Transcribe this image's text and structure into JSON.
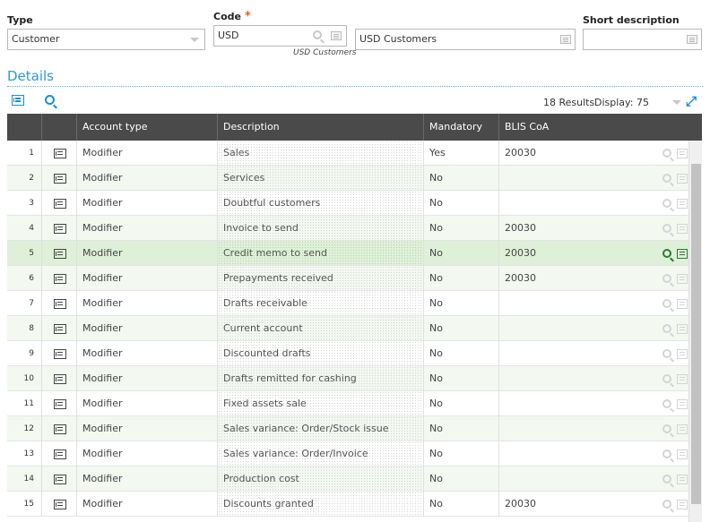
{
  "form": {
    "type": {
      "label": "Type",
      "value": "Customer"
    },
    "code": {
      "label": "Code",
      "required_marker": "*",
      "value": "USD",
      "caption": "USD Customers"
    },
    "description": {
      "value": "USD Customers"
    },
    "short_description": {
      "label": "Short description",
      "value": ""
    }
  },
  "details": {
    "title": "Details",
    "results": "18 Results",
    "display_label": "Display:",
    "display_value": "75"
  },
  "table": {
    "columns": [
      "Account type",
      "Description",
      "Mandatory",
      "BLIS CoA"
    ],
    "rows": [
      {
        "num": "1",
        "account_type": "Modifier",
        "description": "Sales",
        "mandatory": "Yes",
        "blis": "20030"
      },
      {
        "num": "2",
        "account_type": "Modifier",
        "description": "Services",
        "mandatory": "No",
        "blis": ""
      },
      {
        "num": "3",
        "account_type": "Modifier",
        "description": "Doubtful customers",
        "mandatory": "No",
        "blis": ""
      },
      {
        "num": "4",
        "account_type": "Modifier",
        "description": "Invoice to send",
        "mandatory": "No",
        "blis": "20030"
      },
      {
        "num": "5",
        "account_type": "Modifier",
        "description": "Credit memo to send",
        "mandatory": "No",
        "blis": "20030"
      },
      {
        "num": "6",
        "account_type": "Modifier",
        "description": "Prepayments received",
        "mandatory": "No",
        "blis": "20030"
      },
      {
        "num": "7",
        "account_type": "Modifier",
        "description": "Drafts receivable",
        "mandatory": "No",
        "blis": ""
      },
      {
        "num": "8",
        "account_type": "Modifier",
        "description": "Current account",
        "mandatory": "No",
        "blis": ""
      },
      {
        "num": "9",
        "account_type": "Modifier",
        "description": "Discounted drafts",
        "mandatory": "No",
        "blis": ""
      },
      {
        "num": "10",
        "account_type": "Modifier",
        "description": "Drafts remitted for cashing",
        "mandatory": "No",
        "blis": ""
      },
      {
        "num": "11",
        "account_type": "Modifier",
        "description": "Fixed assets sale",
        "mandatory": "No",
        "blis": ""
      },
      {
        "num": "12",
        "account_type": "Modifier",
        "description": "Sales variance: Order/Stock issue",
        "mandatory": "No",
        "blis": ""
      },
      {
        "num": "13",
        "account_type": "Modifier",
        "description": "Sales variance: Order/Invoice",
        "mandatory": "No",
        "blis": ""
      },
      {
        "num": "14",
        "account_type": "Modifier",
        "description": "Production cost",
        "mandatory": "No",
        "blis": ""
      },
      {
        "num": "15",
        "account_type": "Modifier",
        "description": "Discounts granted",
        "mandatory": "No",
        "blis": "20030"
      }
    ],
    "selected_row": "5"
  },
  "colors": {
    "accent": "#2a9bd4",
    "header_bg": "#4a4a4a",
    "selected_row": "#dff0d8",
    "alt_row": "#f3f8f1",
    "required": "#e8601c"
  },
  "icons": [
    "list-icon",
    "search-icon",
    "expand-icon",
    "row-detail-icon",
    "chevron-down-icon"
  ]
}
